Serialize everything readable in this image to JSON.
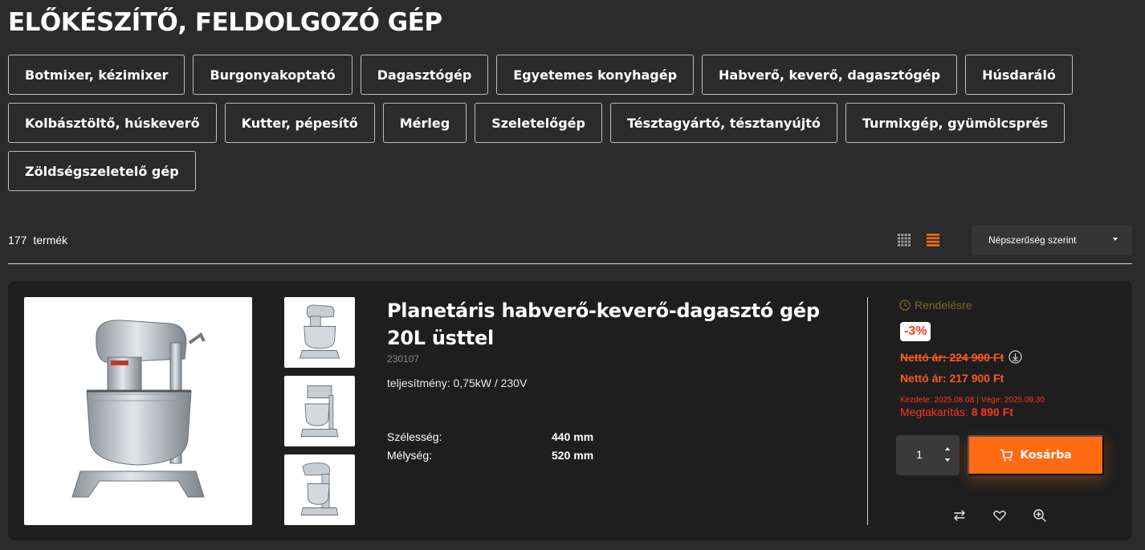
{
  "page": {
    "title": "ELŐKÉSZÍTŐ, FELDOLGOZÓ GÉP"
  },
  "categories": {
    "row1": [
      "Botmixer, kézimixer",
      "Burgonyakoptató",
      "Dagasztógép",
      "Egyetemes konyhagép",
      "Habverő, keverő, dagasztógép",
      "Húsdaráló"
    ],
    "row2": [
      "Kolbásztöltő, húskeverő",
      "Kutter, pépesítő",
      "Mérleg",
      "Szeletelőgép",
      "Tésztagyártó, tésztanyújtó",
      "Turmixgép, gyümölcsprés"
    ],
    "row3": [
      "Zöldségszeletelő gép"
    ]
  },
  "toolbar": {
    "count": "177",
    "count_label": "termék",
    "grid_icon": "grid-view-icon",
    "list_icon": "list-view-icon",
    "sort_value": "Népszerűség szerint",
    "accent_color": "#ff6a13"
  },
  "product": {
    "title": "Planetáris habverő-keverő-dagasztó gép 20L üsttel",
    "sku": "230107",
    "spec_line": "teljesítmény: 0,75kW / 230V",
    "specs": [
      {
        "key": "Szélesség:",
        "value": "440 mm"
      },
      {
        "key": "Mélység:",
        "value": "520 mm"
      }
    ],
    "availability": "Rendelésre",
    "discount_badge": "-3%",
    "old_price": "Nettó ár: 224 900 Ft",
    "new_price": "Nettó ár: 217 900 Ft",
    "period_start": "Kezdete: 2025.08.08",
    "period_sep": "|",
    "period_end": "Vége: 2025.09.30",
    "saving_label": "Megtakarítás:",
    "saving_value": "8 890 Ft",
    "quantity": "1",
    "cart_label": "Kosárba",
    "price_color": "#ff5a1f",
    "actions": [
      "compare-icon",
      "heart-icon",
      "zoom-icon"
    ]
  }
}
